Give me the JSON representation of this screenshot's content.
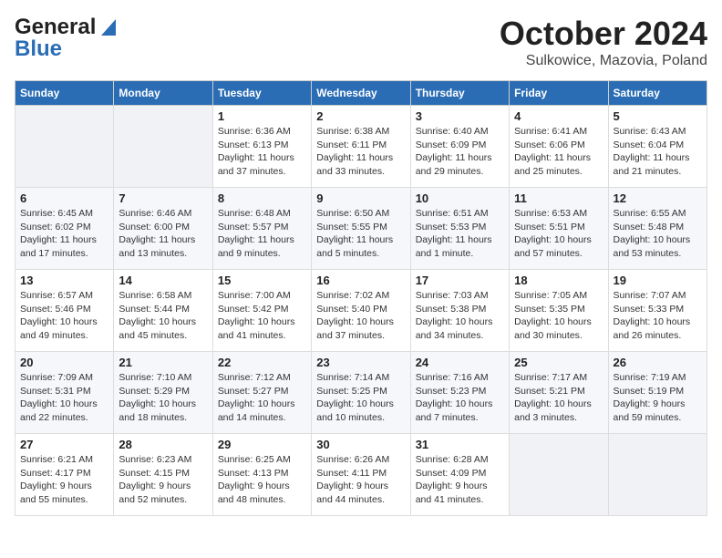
{
  "header": {
    "logo_general": "General",
    "logo_blue": "Blue",
    "month": "October 2024",
    "location": "Sulkowice, Mazovia, Poland"
  },
  "days_of_week": [
    "Sunday",
    "Monday",
    "Tuesday",
    "Wednesday",
    "Thursday",
    "Friday",
    "Saturday"
  ],
  "weeks": [
    [
      {
        "day": "",
        "info": ""
      },
      {
        "day": "",
        "info": ""
      },
      {
        "day": "1",
        "info": "Sunrise: 6:36 AM\nSunset: 6:13 PM\nDaylight: 11 hours\nand 37 minutes."
      },
      {
        "day": "2",
        "info": "Sunrise: 6:38 AM\nSunset: 6:11 PM\nDaylight: 11 hours\nand 33 minutes."
      },
      {
        "day": "3",
        "info": "Sunrise: 6:40 AM\nSunset: 6:09 PM\nDaylight: 11 hours\nand 29 minutes."
      },
      {
        "day": "4",
        "info": "Sunrise: 6:41 AM\nSunset: 6:06 PM\nDaylight: 11 hours\nand 25 minutes."
      },
      {
        "day": "5",
        "info": "Sunrise: 6:43 AM\nSunset: 6:04 PM\nDaylight: 11 hours\nand 21 minutes."
      }
    ],
    [
      {
        "day": "6",
        "info": "Sunrise: 6:45 AM\nSunset: 6:02 PM\nDaylight: 11 hours\nand 17 minutes."
      },
      {
        "day": "7",
        "info": "Sunrise: 6:46 AM\nSunset: 6:00 PM\nDaylight: 11 hours\nand 13 minutes."
      },
      {
        "day": "8",
        "info": "Sunrise: 6:48 AM\nSunset: 5:57 PM\nDaylight: 11 hours\nand 9 minutes."
      },
      {
        "day": "9",
        "info": "Sunrise: 6:50 AM\nSunset: 5:55 PM\nDaylight: 11 hours\nand 5 minutes."
      },
      {
        "day": "10",
        "info": "Sunrise: 6:51 AM\nSunset: 5:53 PM\nDaylight: 11 hours\nand 1 minute."
      },
      {
        "day": "11",
        "info": "Sunrise: 6:53 AM\nSunset: 5:51 PM\nDaylight: 10 hours\nand 57 minutes."
      },
      {
        "day": "12",
        "info": "Sunrise: 6:55 AM\nSunset: 5:48 PM\nDaylight: 10 hours\nand 53 minutes."
      }
    ],
    [
      {
        "day": "13",
        "info": "Sunrise: 6:57 AM\nSunset: 5:46 PM\nDaylight: 10 hours\nand 49 minutes."
      },
      {
        "day": "14",
        "info": "Sunrise: 6:58 AM\nSunset: 5:44 PM\nDaylight: 10 hours\nand 45 minutes."
      },
      {
        "day": "15",
        "info": "Sunrise: 7:00 AM\nSunset: 5:42 PM\nDaylight: 10 hours\nand 41 minutes."
      },
      {
        "day": "16",
        "info": "Sunrise: 7:02 AM\nSunset: 5:40 PM\nDaylight: 10 hours\nand 37 minutes."
      },
      {
        "day": "17",
        "info": "Sunrise: 7:03 AM\nSunset: 5:38 PM\nDaylight: 10 hours\nand 34 minutes."
      },
      {
        "day": "18",
        "info": "Sunrise: 7:05 AM\nSunset: 5:35 PM\nDaylight: 10 hours\nand 30 minutes."
      },
      {
        "day": "19",
        "info": "Sunrise: 7:07 AM\nSunset: 5:33 PM\nDaylight: 10 hours\nand 26 minutes."
      }
    ],
    [
      {
        "day": "20",
        "info": "Sunrise: 7:09 AM\nSunset: 5:31 PM\nDaylight: 10 hours\nand 22 minutes."
      },
      {
        "day": "21",
        "info": "Sunrise: 7:10 AM\nSunset: 5:29 PM\nDaylight: 10 hours\nand 18 minutes."
      },
      {
        "day": "22",
        "info": "Sunrise: 7:12 AM\nSunset: 5:27 PM\nDaylight: 10 hours\nand 14 minutes."
      },
      {
        "day": "23",
        "info": "Sunrise: 7:14 AM\nSunset: 5:25 PM\nDaylight: 10 hours\nand 10 minutes."
      },
      {
        "day": "24",
        "info": "Sunrise: 7:16 AM\nSunset: 5:23 PM\nDaylight: 10 hours\nand 7 minutes."
      },
      {
        "day": "25",
        "info": "Sunrise: 7:17 AM\nSunset: 5:21 PM\nDaylight: 10 hours\nand 3 minutes."
      },
      {
        "day": "26",
        "info": "Sunrise: 7:19 AM\nSunset: 5:19 PM\nDaylight: 9 hours\nand 59 minutes."
      }
    ],
    [
      {
        "day": "27",
        "info": "Sunrise: 6:21 AM\nSunset: 4:17 PM\nDaylight: 9 hours\nand 55 minutes."
      },
      {
        "day": "28",
        "info": "Sunrise: 6:23 AM\nSunset: 4:15 PM\nDaylight: 9 hours\nand 52 minutes."
      },
      {
        "day": "29",
        "info": "Sunrise: 6:25 AM\nSunset: 4:13 PM\nDaylight: 9 hours\nand 48 minutes."
      },
      {
        "day": "30",
        "info": "Sunrise: 6:26 AM\nSunset: 4:11 PM\nDaylight: 9 hours\nand 44 minutes."
      },
      {
        "day": "31",
        "info": "Sunrise: 6:28 AM\nSunset: 4:09 PM\nDaylight: 9 hours\nand 41 minutes."
      },
      {
        "day": "",
        "info": ""
      },
      {
        "day": "",
        "info": ""
      }
    ]
  ]
}
